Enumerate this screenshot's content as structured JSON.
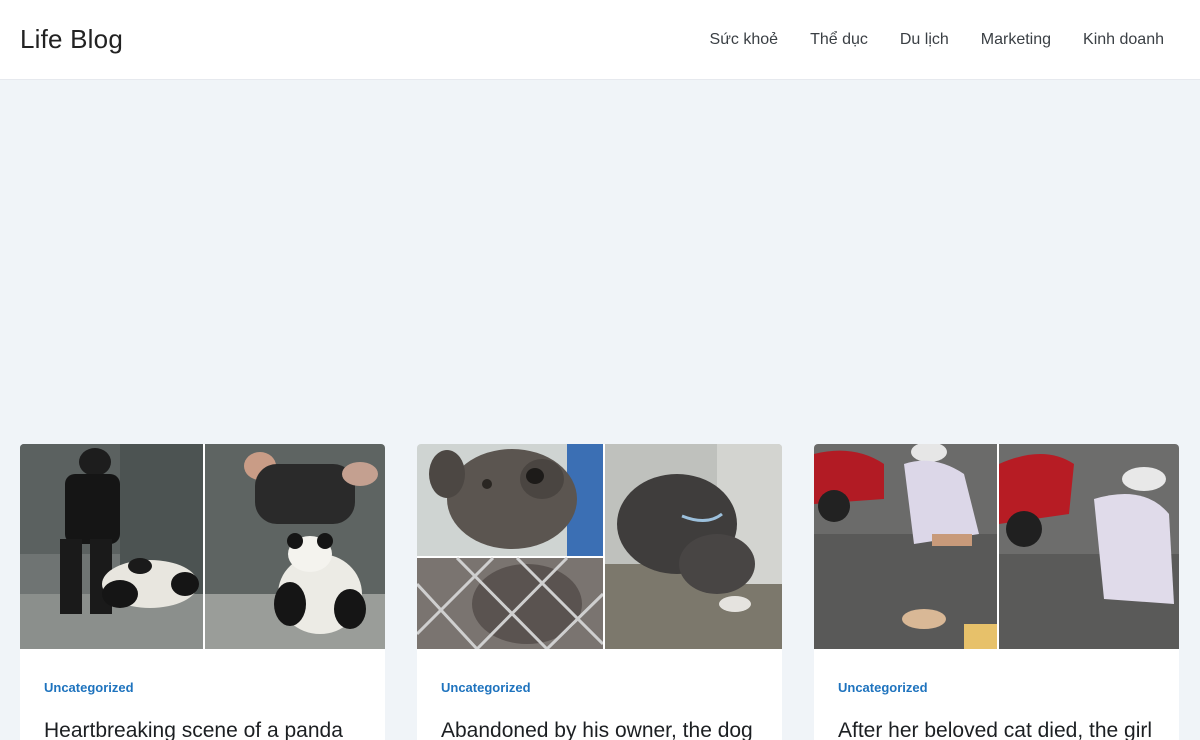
{
  "site": {
    "logo": "Life Blog"
  },
  "nav": {
    "items": [
      {
        "label": "Sức khoẻ"
      },
      {
        "label": "Thể dục"
      },
      {
        "label": "Du lịch"
      },
      {
        "label": "Marketing"
      },
      {
        "label": "Kinh doanh"
      }
    ]
  },
  "posts": [
    {
      "category": "Uncategorized",
      "title": "Heartbreaking scene of a panda",
      "image": "panda-keeper-photo"
    },
    {
      "category": "Uncategorized",
      "title": "Abandoned by his owner, the dog",
      "image": "shelter-dog-photo"
    },
    {
      "category": "Uncategorized",
      "title": "After her beloved cat died, the girl",
      "image": "girl-and-cat-photo"
    }
  ]
}
